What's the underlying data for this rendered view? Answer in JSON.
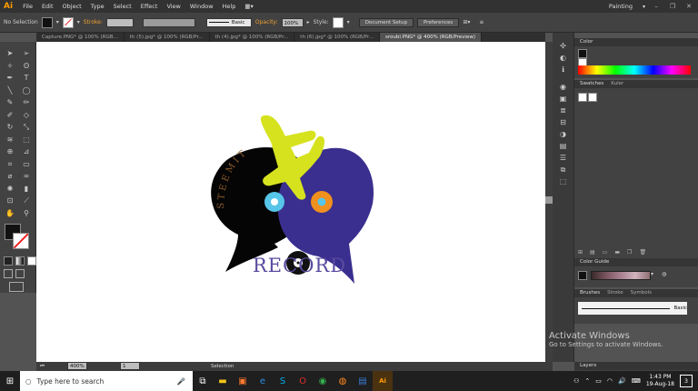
{
  "menubar": {
    "logo": "Ai",
    "items": [
      "File",
      "Edit",
      "Object",
      "Type",
      "Select",
      "Effect",
      "View",
      "Window",
      "Help"
    ],
    "workspace": "Painting"
  },
  "control": {
    "selection": "No Selection",
    "stroke_label": "Stroke:",
    "brush": "Basic",
    "opacity_label": "Opacity:",
    "opacity_value": "100%",
    "style_label": "Style:",
    "doc_setup": "Document Setup",
    "preferences": "Preferences"
  },
  "tabs": [
    "Capture.PNG* @ 100% (RGB...",
    "th (5).jpg* @ 100% (RGB/Pr...",
    "th (4).jpg* @ 100% (RGB/Pr...",
    "th (6).jpg* @ 100% (RGB/Pr...",
    "sroubl.PNG* @ 400% (RGB/Preview)"
  ],
  "artwork": {
    "arc_text": "STEEMIT",
    "record_text": "RECORD"
  },
  "panels": {
    "color": "Color",
    "swatches": "Swatches",
    "kuler": "Kuler",
    "color_guide": "Color Guide",
    "brushes": "Brushes",
    "stroke": "Stroke",
    "symbols": "Symbols",
    "basic": "Basic",
    "layers": "Layers"
  },
  "status": {
    "zoom": "400%",
    "page": "1",
    "mode": "Selection"
  },
  "watermark": {
    "line1": "Activate Windows",
    "line2": "Go to Settings to activate Windows."
  },
  "taskbar": {
    "search_placeholder": "Type here to search",
    "time": "1:43 PM",
    "date": "19-Aug-18",
    "badge": "3"
  },
  "colors": {
    "blue_bubble": "#3a2f8f",
    "black_bubble": "#050505",
    "yellow_plane": "#d6e21e",
    "cyan_ring": "#56c5e8",
    "orange_ring": "#f0901e",
    "ai_orange": "#ff9a00"
  }
}
